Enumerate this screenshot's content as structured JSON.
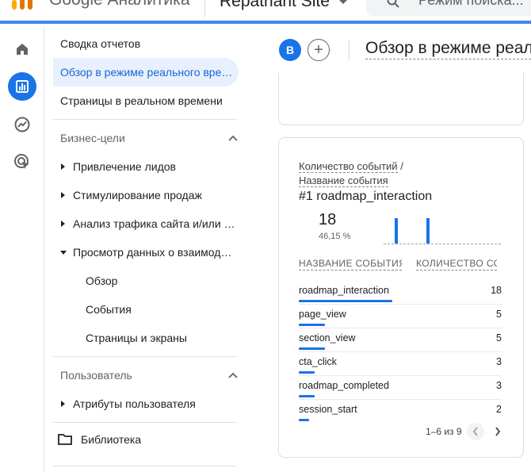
{
  "colors": {
    "accent": "#1a73e8",
    "selected_bg": "#e8f0fe",
    "selected_text": "#1967d2"
  },
  "topbar": {
    "app_title": "Google Аналитика",
    "property_name": "Repatriant Site",
    "search_placeholder": "Режим поиска..."
  },
  "rail": {
    "items": [
      {
        "icon": "home-icon"
      },
      {
        "icon": "reports-icon",
        "active": true
      },
      {
        "icon": "explore-icon"
      },
      {
        "icon": "advertising-icon"
      }
    ]
  },
  "nav": {
    "reports_snapshot": "Сводка отчетов",
    "realtime_overview": "Обзор в режиме реального времени",
    "realtime_pages": "Страницы в реальном времени",
    "section_business": "Бизнес-цели",
    "lead_generation": "Привлечение лидов",
    "drive_sales": "Стимулирование продаж",
    "traffic_analysis": "Анализ трафика сайта и/или приложения",
    "engagement": "Просмотр данных о взаимодействии",
    "overview": "Обзор",
    "events": "События",
    "pages_screens": "Страницы и экраны",
    "section_user": "Пользователь",
    "user_attributes": "Атрибуты пользователя",
    "library": "Библиотека"
  },
  "main": {
    "avatar_letter": "B",
    "add_symbol": "+",
    "report_title": "Обзор в режиме реального времени",
    "card": {
      "metric_title_part1": "Количество событий",
      "metric_slash": " /",
      "metric_title_part2": "Название события",
      "top_rank": "#1",
      "top_event": "roadmap_interaction",
      "top_value": "18",
      "top_percent": "46,15 %",
      "sparkline_bars": [
        0.85,
        0.85
      ],
      "col_event": "Название события",
      "col_count": "Количество событий",
      "rows": [
        {
          "name": "roadmap_interaction",
          "value": "18",
          "share": 1.0
        },
        {
          "name": "page_view",
          "value": "5",
          "share": 0.28
        },
        {
          "name": "section_view",
          "value": "5",
          "share": 0.28
        },
        {
          "name": "cta_click",
          "value": "3",
          "share": 0.17
        },
        {
          "name": "roadmap_completed",
          "value": "3",
          "share": 0.17
        },
        {
          "name": "session_start",
          "value": "2",
          "share": 0.11
        }
      ],
      "pager_text": "1–6 из 9"
    }
  }
}
